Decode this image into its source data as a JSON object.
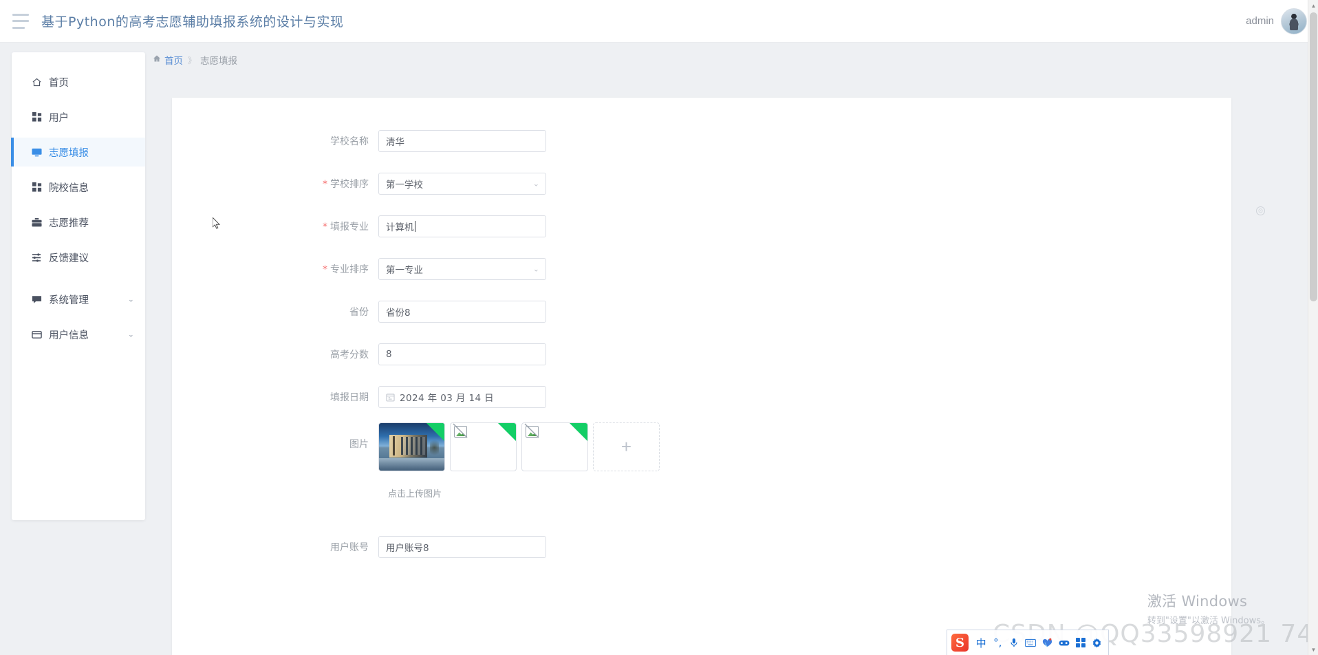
{
  "topbar": {
    "menu_icon": "hamburger-icon",
    "title": "基于Python的高考志愿辅助填报系统的设计与实现",
    "user": "admin",
    "avatar_icon": "user-avatar"
  },
  "sidebar": {
    "items": [
      {
        "label": "首页",
        "icon": "home-icon",
        "active": false,
        "expandable": false
      },
      {
        "label": "用户",
        "icon": "grid-icon",
        "active": false,
        "expandable": false
      },
      {
        "label": "志愿填报",
        "icon": "monitor-icon",
        "active": true,
        "expandable": false
      },
      {
        "label": "院校信息",
        "icon": "grid-icon",
        "active": false,
        "expandable": false
      },
      {
        "label": "志愿推荐",
        "icon": "briefcase-icon",
        "active": false,
        "expandable": false
      },
      {
        "label": "反馈建议",
        "icon": "sliders-icon",
        "active": false,
        "expandable": false
      },
      {
        "label": "系统管理",
        "icon": "chat-icon",
        "active": false,
        "expandable": true
      },
      {
        "label": "用户信息",
        "icon": "card-icon",
        "active": false,
        "expandable": true
      }
    ],
    "caret_glyph": "⌄"
  },
  "breadcrumb": {
    "home_icon": "home-icon",
    "home": "首页",
    "separator": "》",
    "current": "志愿填报"
  },
  "form": {
    "rows": [
      {
        "label": "学校名称",
        "required": false,
        "type": "input",
        "value": "清华",
        "caret": false
      },
      {
        "label": "学校排序",
        "required": true,
        "type": "select",
        "value": "第一学校",
        "caret": false
      },
      {
        "label": "填报专业",
        "required": true,
        "type": "input",
        "value": "计算机",
        "caret": true
      },
      {
        "label": "专业排序",
        "required": true,
        "type": "select",
        "value": "第一专业",
        "caret": false
      },
      {
        "label": "省份",
        "required": false,
        "type": "input",
        "value": "省份8",
        "caret": false
      },
      {
        "label": "高考分数",
        "required": false,
        "type": "input",
        "value": "8",
        "caret": false
      },
      {
        "label": "填报日期",
        "required": false,
        "type": "date",
        "value": "2024 年 03 月 14 日",
        "caret": false
      }
    ],
    "upload": {
      "label": "图片",
      "tip": "点击上传图片",
      "add_glyph": "+",
      "thumbs": [
        {
          "kind": "photo",
          "alt": "校园建筑照片"
        },
        {
          "kind": "broken",
          "alt": "图片加载失败"
        },
        {
          "kind": "broken",
          "alt": "图片加载失败"
        }
      ]
    },
    "bottom_row": {
      "label": "用户账号",
      "required": false,
      "type": "input",
      "value": "用户账号8"
    },
    "select_caret_glyph": "⌄",
    "date_icon": "calendar-icon"
  },
  "overlays": {
    "float_dot": "⊙",
    "windows_activation_title": "激活 Windows",
    "windows_activation_sub": "转到\"设置\"以激活 Windows。",
    "csdn_watermark": "CSDN @QQ33598921 74"
  },
  "taskbar": {
    "ime_logo": "S",
    "items": [
      {
        "icon": "ime-chinese-icon",
        "glyph": "中"
      },
      {
        "icon": "ime-punctuation-icon",
        "glyph": "°,"
      },
      {
        "icon": "microphone-icon",
        "glyph": "🎤"
      },
      {
        "icon": "keyboard-icon",
        "glyph": "⌨"
      },
      {
        "icon": "emoji-icon",
        "glyph": "✦"
      },
      {
        "icon": "game-controller-icon",
        "glyph": "🎮"
      },
      {
        "icon": "apps-grid-icon",
        "glyph": "▦"
      },
      {
        "icon": "settings-gear-icon",
        "glyph": "⚙"
      }
    ]
  },
  "scrollbar": {
    "up_glyph": "▲",
    "down_glyph": "▼"
  },
  "colors": {
    "accent": "#3a8ee6",
    "title": "#5b7ea6",
    "required": "#f56c6c",
    "corner_green": "#13ce66",
    "border": "#dcdfe6"
  }
}
